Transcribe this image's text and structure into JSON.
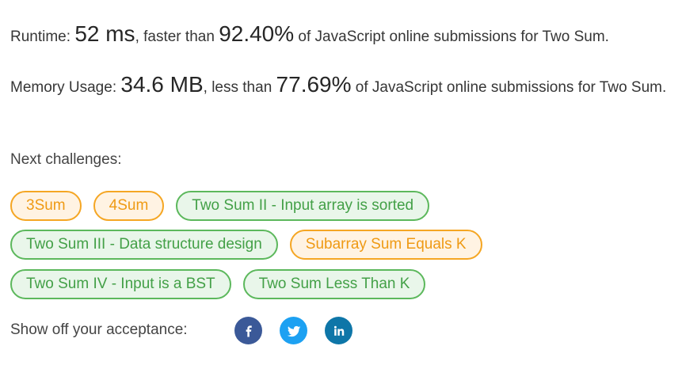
{
  "runtime": {
    "label": "Runtime: ",
    "value": "52 ms",
    "faster_text": ", faster than ",
    "percent": "92.40%",
    "suffix": " of JavaScript online submissions for Two Sum."
  },
  "memory": {
    "label": "Memory Usage: ",
    "value": "34.6 MB",
    "less_text": ", less than ",
    "percent": "77.69%",
    "suffix": " of JavaScript online submissions for Two Sum."
  },
  "next_challenges_label": "Next challenges:",
  "challenges": {
    "row1": [
      {
        "label": "3Sum",
        "difficulty": "medium"
      },
      {
        "label": "4Sum",
        "difficulty": "medium"
      },
      {
        "label": "Two Sum II - Input array is sorted",
        "difficulty": "easy"
      }
    ],
    "row2": [
      {
        "label": "Two Sum III - Data structure design",
        "difficulty": "easy"
      },
      {
        "label": "Subarray Sum Equals K",
        "difficulty": "medium"
      }
    ],
    "row3": [
      {
        "label": "Two Sum IV - Input is a BST",
        "difficulty": "easy"
      },
      {
        "label": "Two Sum Less Than K",
        "difficulty": "easy"
      }
    ]
  },
  "share": {
    "label": "Show off your acceptance:",
    "icons": [
      "facebook-icon",
      "twitter-icon",
      "linkedin-icon"
    ]
  },
  "colors": {
    "medium_border": "#f5a623",
    "medium_text": "#ef9a14",
    "easy_border": "#5cb85c",
    "easy_text": "#43a047",
    "facebook": "#3b5998",
    "twitter": "#1da1f2",
    "linkedin": "#0e76a8"
  }
}
